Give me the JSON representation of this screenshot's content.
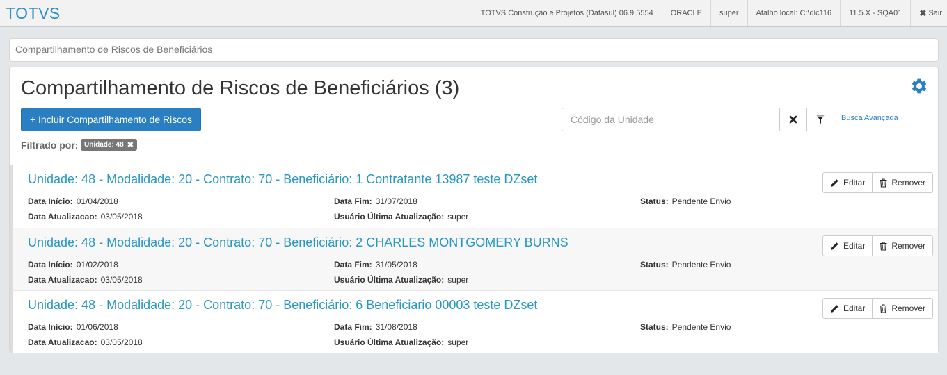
{
  "topbar": {
    "brand": "TOTVS",
    "items": [
      "TOTVS Construção e Projetos (Datasul) 06.9.5554",
      "ORACLE",
      "super",
      "Atalho local: C:\\dlc116",
      "11.5.X - SQA01"
    ],
    "logout": "Sair"
  },
  "breadcrumb": "Compartilhamento de Riscos de Beneficiários",
  "page": {
    "title": "Compartilhamento de Riscos de Beneficiários (3)",
    "primary_button": "+ Incluir Compartilhamento de Riscos",
    "filter_label": "Filtrado por:",
    "filter_chip": "Unidade: 48",
    "search_placeholder": "Código da Unidade",
    "advanced_search": "Busca Avançada"
  },
  "labels": {
    "start": "Data Início:",
    "end": "Data Fim:",
    "status": "Status:",
    "updated": "Data Atualizacao:",
    "user": "Usuário Última Atualização:",
    "edit": "Editar",
    "remove": "Remover"
  },
  "items": [
    {
      "title": "Unidade: 48 - Modalidade: 20 - Contrato: 70 - Beneficiário: 1 Contratante 13987 teste DZset",
      "start": "01/04/2018",
      "end": "31/07/2018",
      "status": "Pendente Envio",
      "updated": "03/05/2018",
      "user": "super"
    },
    {
      "title": "Unidade: 48 - Modalidade: 20 - Contrato: 70 - Beneficiário: 2 CHARLES MONTGOMERY BURNS",
      "start": "01/02/2018",
      "end": "31/05/2018",
      "status": "Pendente Envio",
      "updated": "03/05/2018",
      "user": "super"
    },
    {
      "title": "Unidade: 48 - Modalidade: 20 - Contrato: 70 - Beneficiário: 6 Beneficiario 00003 teste DZset",
      "start": "01/06/2018",
      "end": "31/08/2018",
      "status": "Pendente Envio",
      "updated": "03/05/2018",
      "user": "super"
    }
  ]
}
